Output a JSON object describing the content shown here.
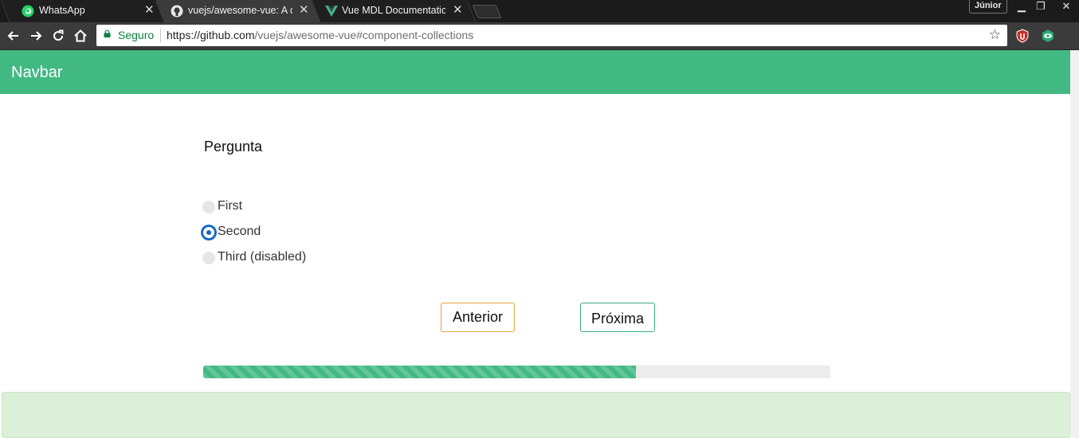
{
  "browser": {
    "tabs": [
      {
        "title": "WhatsApp",
        "icon": "whatsapp-icon",
        "active": false
      },
      {
        "title": "vuejs/awesome-vue: A cu",
        "icon": "github-icon",
        "active": true
      },
      {
        "title": "Vue MDL Documentation",
        "icon": "vue-icon",
        "active": false
      }
    ],
    "close_glyph": "✕",
    "profile": "Júnior",
    "window_controls": {
      "minimize": "▁",
      "restore": "❐",
      "close": "✕"
    },
    "toolbar": {
      "secure_label": "Seguro",
      "url_host": "https://github.com",
      "url_rest": "/vuejs/awesome-vue#component-collections",
      "star": "☆"
    }
  },
  "app": {
    "brand": "Navbar",
    "question": "Pergunta",
    "options": [
      {
        "label": "First",
        "checked": false,
        "disabled": false
      },
      {
        "label": "Second",
        "checked": true,
        "disabled": false
      },
      {
        "label": "Third (disabled)",
        "checked": false,
        "disabled": true
      }
    ],
    "prev_label": "Anterior",
    "next_label": "Próxima",
    "progress_percent": 69
  },
  "colors": {
    "accent": "#42b983",
    "prev_border": "#e8a23a",
    "next_border": "#3aa987",
    "footer_bg": "#dcefd8"
  }
}
